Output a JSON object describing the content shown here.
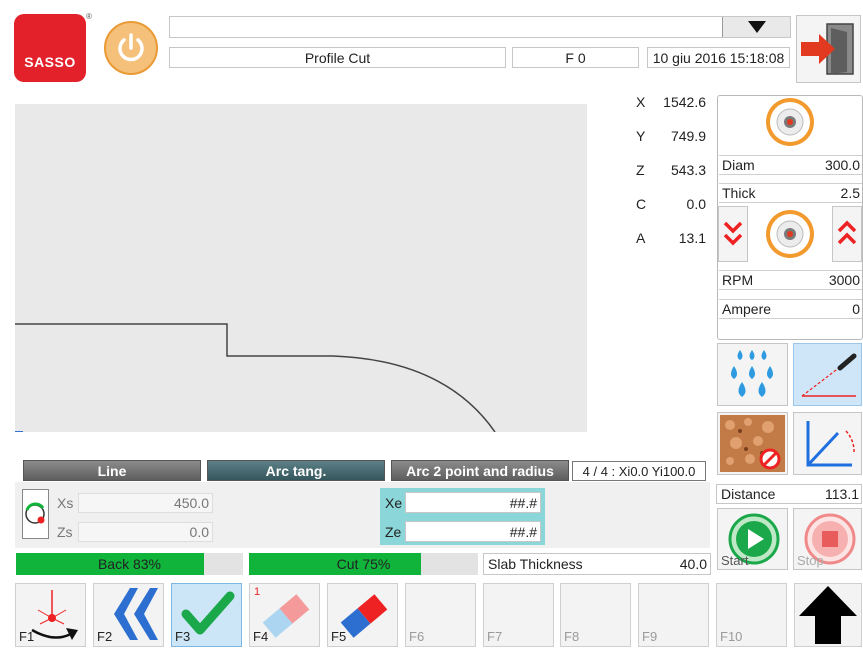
{
  "header": {
    "logo_text": "SASSO",
    "program_dropdown_value": "",
    "mode_label": "Profile Cut",
    "feed_label": "F 0",
    "datetime": "10 giu 2016 15:18:08"
  },
  "coordinates": [
    {
      "axis": "X",
      "value": "1542.6"
    },
    {
      "axis": "Y",
      "value": "749.9"
    },
    {
      "axis": "Z",
      "value": "543.3"
    },
    {
      "axis": "C",
      "value": "0.0"
    },
    {
      "axis": "A",
      "value": "13.1"
    }
  ],
  "blade": {
    "diam_label": "Diam",
    "diam_value": "300.0",
    "thick_label": "Thick",
    "thick_value": "2.5",
    "rpm_label": "RPM",
    "rpm_value": "3000",
    "ampere_label": "Ampere",
    "ampere_value": "0"
  },
  "profile_plot": {
    "color": "#444444",
    "background": "#e9e9e9"
  },
  "segment_buttons": {
    "line": "Line",
    "arc_tang": "Arc tang.",
    "arc_2point": "Arc 2 point and radius",
    "status": "4 / 4 : Xi0.0 Yi100.0"
  },
  "start_inputs": {
    "xs_label": "Xs",
    "xs_value": "450.0",
    "zs_label": "Zs",
    "zs_value": "0.0"
  },
  "end_inputs": {
    "xe_label": "Xe",
    "xe_value": "##.#",
    "ze_label": "Ze",
    "ze_value": "##.#"
  },
  "progress": {
    "back_label": "Back 83%",
    "back_fraction": 0.83,
    "cut_label": "Cut 75%",
    "cut_fraction": 0.75,
    "slab_label": "Slab Thickness",
    "slab_value": "40.0"
  },
  "distance": {
    "label": "Distance",
    "value": "113.1"
  },
  "controls": {
    "start_label": "Start",
    "stop_label": "Stop"
  },
  "fkeys": [
    {
      "label": "F1",
      "icon": "laser-pointer-icon"
    },
    {
      "label": "F2",
      "icon": "double-chevron-left-icon"
    },
    {
      "label": "F3",
      "icon": "checkmark-icon"
    },
    {
      "label": "F4",
      "icon": "eraser-icon",
      "badge": "1"
    },
    {
      "label": "F5",
      "icon": "eraser-icon"
    },
    {
      "label": "F6"
    },
    {
      "label": "F7"
    },
    {
      "label": "F8"
    },
    {
      "label": "F9"
    },
    {
      "label": "F10"
    }
  ],
  "colors": {
    "accent_green": "#10b43a",
    "logo_red": "#e2212b",
    "power_orange": "#f0a236",
    "arrow_red": "#e23a21",
    "selection_blue": "#cde6f7"
  }
}
